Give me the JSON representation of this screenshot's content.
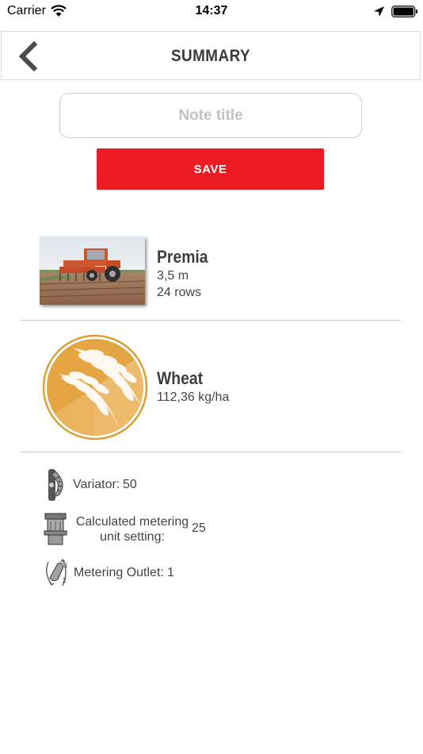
{
  "status_bar": {
    "carrier": "Carrier",
    "time": "14:37"
  },
  "nav": {
    "title": "SUMMARY",
    "back_icon": "chevron-left-icon"
  },
  "form": {
    "note_placeholder": "Note title",
    "note_value": "",
    "save_label": "SAVE",
    "save_color": "#ec1c24"
  },
  "machine": {
    "name": "Premia",
    "width": "3,5 m",
    "rows": "24 rows",
    "image": "tractor-seed-drill-photo"
  },
  "crop": {
    "name": "Wheat",
    "rate": "112,36 kg/ha",
    "icon": "wheat-icon",
    "color": "#e3a43d"
  },
  "settings": [
    {
      "icon": "variator-icon",
      "label": "Variator:",
      "value": "50"
    },
    {
      "icon": "metering-unit-icon",
      "label_line1": "Calculated metering",
      "label_line2": "unit setting:",
      "value": "25"
    },
    {
      "icon": "metering-outlet-icon",
      "label": "Metering Outlet:",
      "value": "1"
    }
  ]
}
